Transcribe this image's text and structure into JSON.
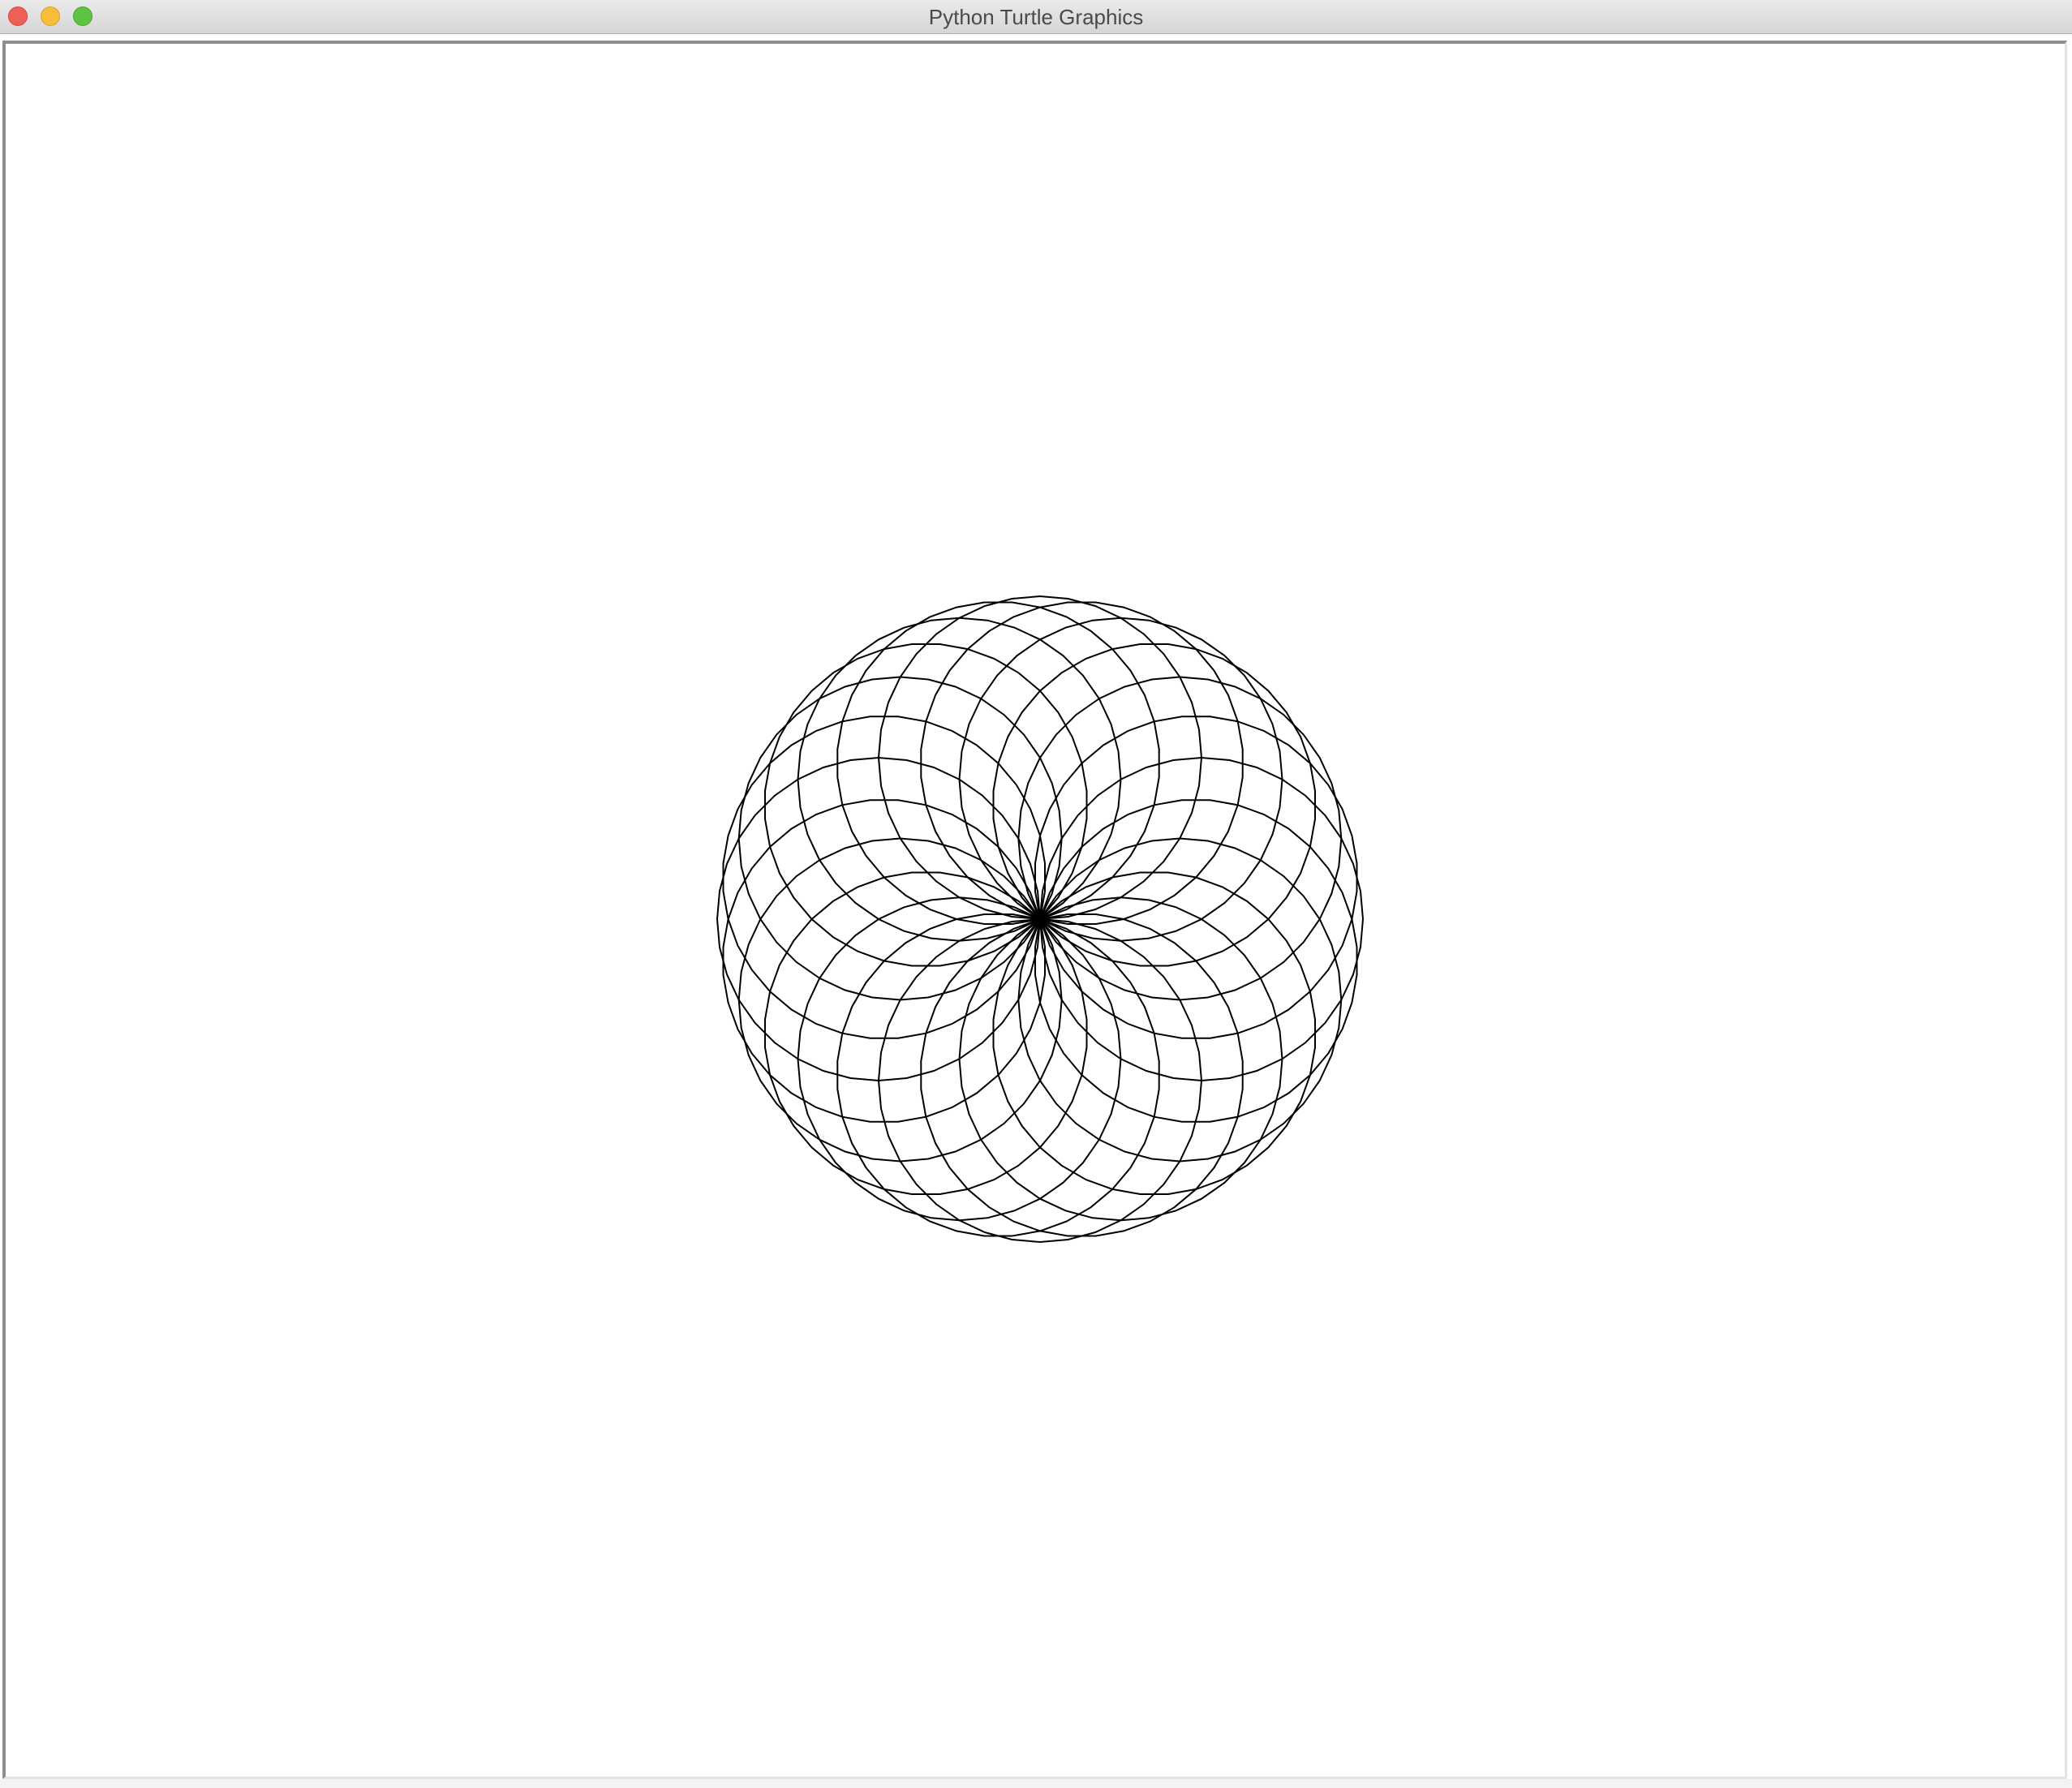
{
  "window": {
    "title": "Python Turtle Graphics"
  },
  "titlebar_buttons": [
    {
      "name": "close",
      "color": "#ee5f58"
    },
    {
      "name": "minimize",
      "color": "#f6bd3c"
    },
    {
      "name": "zoom",
      "color": "#5ec342"
    }
  ],
  "canvas": {
    "background": "#ffffff",
    "pen_color": "#000000",
    "pattern": {
      "shape": "polygon circles rotated about a common point",
      "circle_count": 24,
      "sides_per_circle": 36
    }
  }
}
